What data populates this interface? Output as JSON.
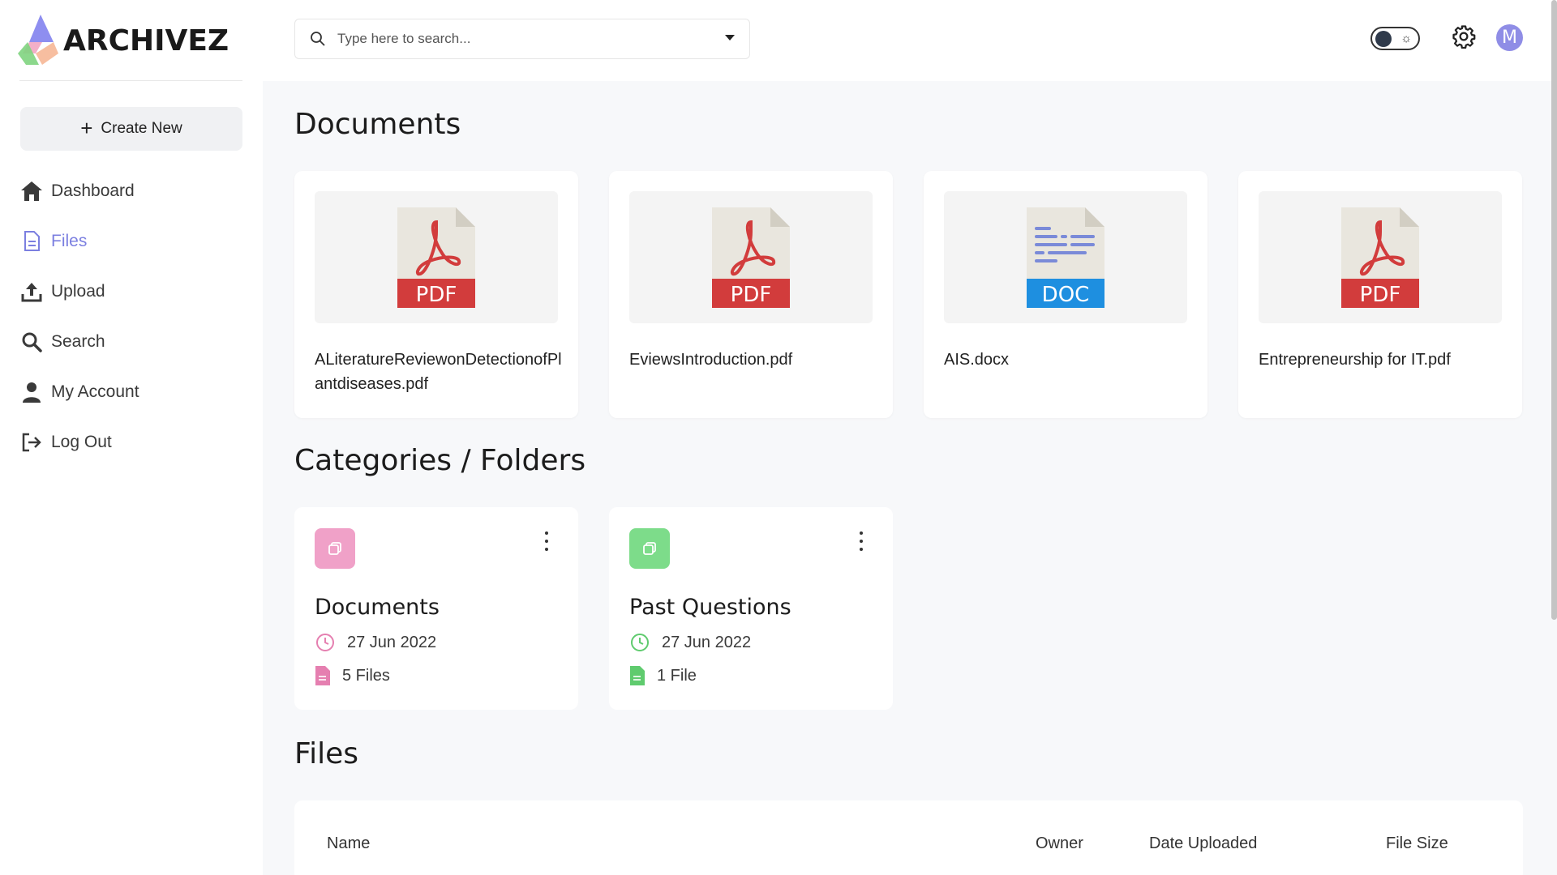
{
  "app": {
    "name": "ARCHIVEZ"
  },
  "sidebar": {
    "create_label": "Create New",
    "items": [
      {
        "label": "Dashboard",
        "icon": "home-icon"
      },
      {
        "label": "Files",
        "icon": "file-icon",
        "active": true
      },
      {
        "label": "Upload",
        "icon": "upload-icon"
      },
      {
        "label": "Search",
        "icon": "search-icon"
      },
      {
        "label": "My Account",
        "icon": "user-icon"
      },
      {
        "label": "Log Out",
        "icon": "logout-icon"
      }
    ]
  },
  "topbar": {
    "search_placeholder": "Type here to search...",
    "avatar_initial": "M"
  },
  "documents": {
    "title": "Documents",
    "items": [
      {
        "name": "ALiteratureReviewonDetectionofPlantdiseases.pdf",
        "type": "PDF"
      },
      {
        "name": "EviewsIntroduction.pdf",
        "type": "PDF"
      },
      {
        "name": "AIS.docx",
        "type": "DOC"
      },
      {
        "name": "Entrepreneurship for IT.pdf",
        "type": "PDF"
      }
    ]
  },
  "folders": {
    "title": "Categories / Folders",
    "items": [
      {
        "name": "Documents",
        "date": "27 Jun 2022",
        "count": "5 Files",
        "color": "#f0a1c8",
        "accent": "#e57fb0"
      },
      {
        "name": "Past Questions",
        "date": "27 Jun 2022",
        "count": "1 File",
        "color": "#7ddc8a",
        "accent": "#5fcb6e"
      }
    ]
  },
  "files": {
    "title": "Files",
    "columns": [
      "Name",
      "Owner",
      "Date Uploaded",
      "File Size"
    ]
  },
  "colors": {
    "accent": "#7b7fe0",
    "pdf_red": "#d23c3c",
    "doc_blue": "#1e8fe0"
  }
}
